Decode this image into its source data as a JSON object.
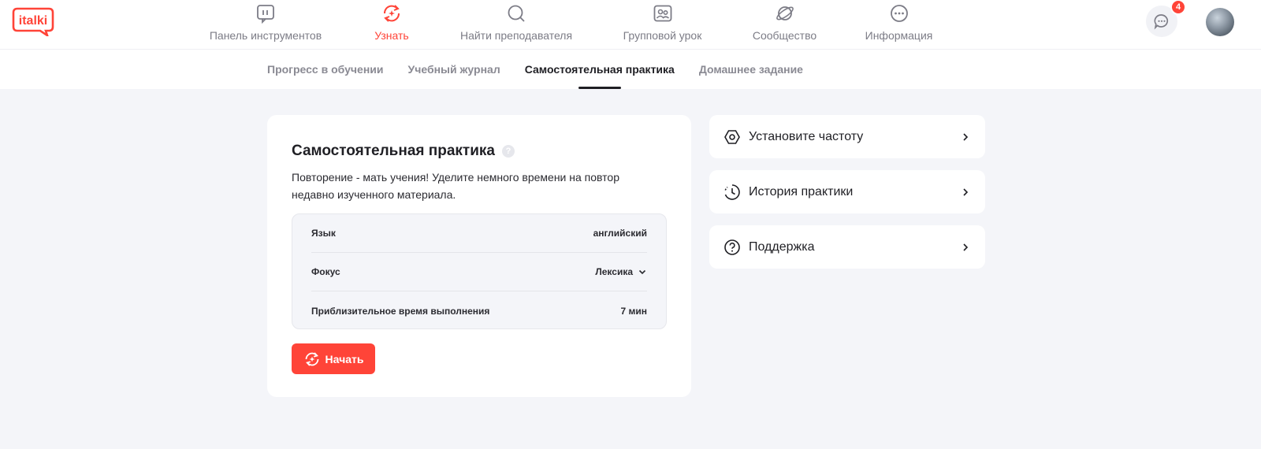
{
  "brand": {
    "logo_text": "italki",
    "accent": "#ff4438"
  },
  "nav": {
    "items": [
      {
        "label": "Панель инструментов",
        "icon": "dashboard-icon",
        "active": false
      },
      {
        "label": "Узнать",
        "icon": "learn-icon",
        "active": true
      },
      {
        "label": "Найти преподавателя",
        "icon": "search-icon",
        "active": false
      },
      {
        "label": "Групповой урок",
        "icon": "group-class-icon",
        "active": false
      },
      {
        "label": "Сообщество",
        "icon": "community-icon",
        "active": false
      },
      {
        "label": "Информация",
        "icon": "more-icon",
        "active": false
      }
    ],
    "notifications_count": "4"
  },
  "subnav": {
    "tabs": [
      {
        "label": "Прогресс в обучении",
        "active": false
      },
      {
        "label": "Учебный журнал",
        "active": false
      },
      {
        "label": "Самостоятельная практика",
        "active": true
      },
      {
        "label": "Домашнее задание",
        "active": false
      }
    ]
  },
  "practice": {
    "title": "Самостоятельная практика",
    "help_glyph": "?",
    "description": "Повторение - мать учения! Уделите немного времени на повтор недавно изученного материала.",
    "rows": [
      {
        "label": "Язык",
        "value": "английский"
      },
      {
        "label": "Фокус",
        "value": "Лексика"
      },
      {
        "label": "Приблизительное время выполнения",
        "value": "7 мин"
      }
    ],
    "start_label": "Начать"
  },
  "side": {
    "items": [
      {
        "label": "Установите частоту",
        "icon": "frequency-icon"
      },
      {
        "label": "История практики",
        "icon": "history-icon"
      },
      {
        "label": "Поддержка",
        "icon": "help-icon"
      }
    ]
  }
}
